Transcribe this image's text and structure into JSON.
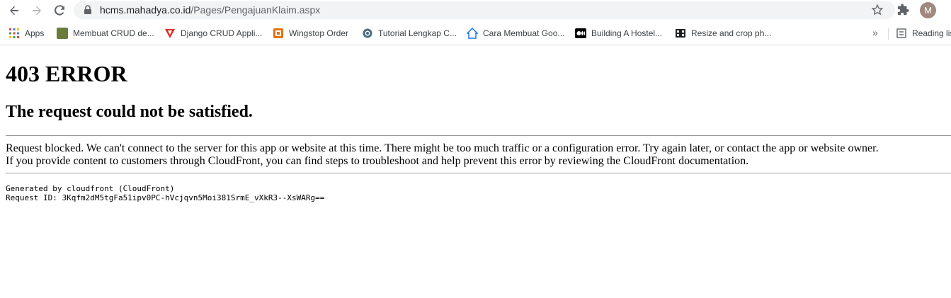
{
  "browser": {
    "url_host": "hcms.mahadya.co.id",
    "url_path": "/Pages/PengajuanKlaim.aspx",
    "profile_initial": "M",
    "bookmarks": [
      {
        "label": "Apps",
        "icon": "apps-grid-icon"
      },
      {
        "label": "Membuat CRUD de...",
        "icon": "site-favicon"
      },
      {
        "label": "Django CRUD Appli...",
        "icon": "red-v-favicon"
      },
      {
        "label": "Wingstop Order",
        "icon": "orange-box-favicon"
      },
      {
        "label": "Tutorial Lengkap C...",
        "icon": "gear-favicon"
      },
      {
        "label": "Cara Membuat Goo...",
        "icon": "house-favicon"
      },
      {
        "label": "Building A Hostel...",
        "icon": "medium-favicon"
      },
      {
        "label": "Resize and crop ph...",
        "icon": "film-favicon"
      }
    ],
    "more_label": "»",
    "reading_list": "Reading list"
  },
  "page": {
    "heading": "403 ERROR",
    "subheading": "The request could not be satisfied.",
    "line1": "Request blocked. We can't connect to the server for this app or website at this time. There might be too much traffic or a configuration error. Try again later, or contact the app or website owner.",
    "line2": "If you provide content to customers through CloudFront, you can find steps to troubleshoot and help prevent this error by reviewing the CloudFront documentation.",
    "generated": "Generated by cloudfront (CloudFront)",
    "request_id": "Request ID: 3Kqfm2dM5tgFa51ipv0PC-hVcjqvn5Moi381SrmE_vXkR3--XsWARg=="
  }
}
